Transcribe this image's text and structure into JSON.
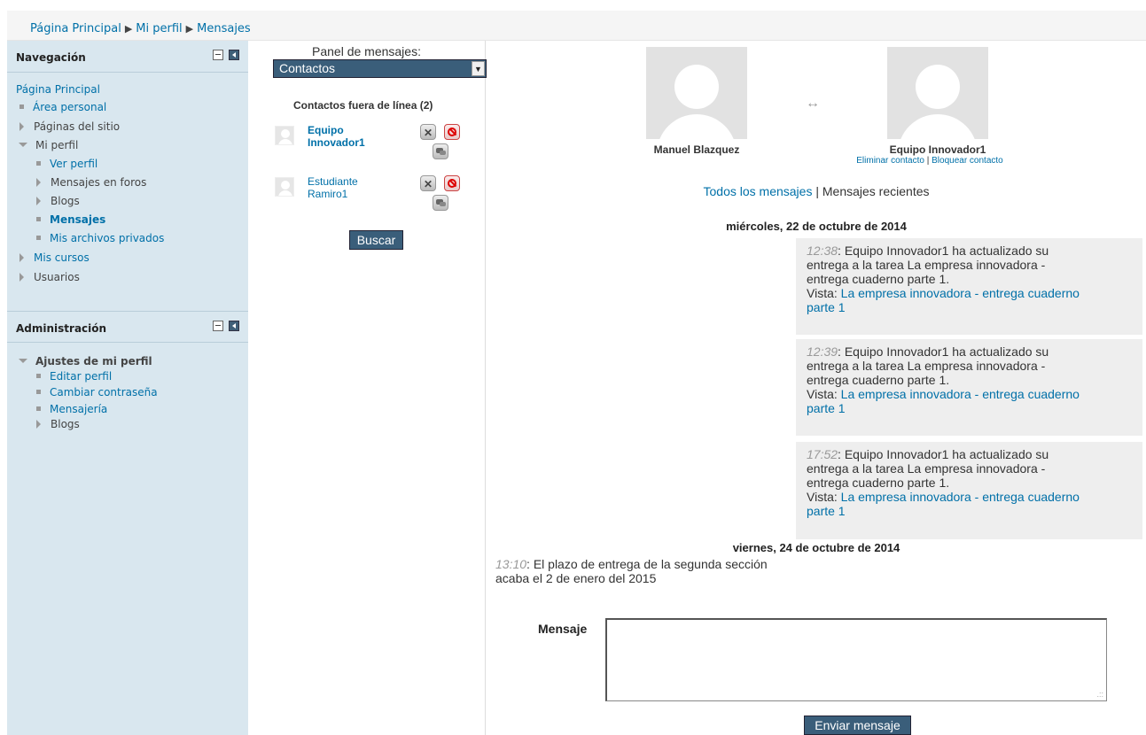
{
  "breadcrumb": {
    "items": [
      "Página Principal",
      "Mi perfil",
      "Mensajes"
    ],
    "separator": "▶"
  },
  "navigation_block": {
    "title": "Navegación",
    "home": "Página Principal",
    "items": [
      {
        "label": "Área personal",
        "marker": "bullet"
      },
      {
        "label": "Páginas del sitio",
        "marker": "collapsed"
      },
      {
        "label": "Mi perfil",
        "marker": "expanded"
      },
      {
        "label": "Ver perfil",
        "marker": "bullet"
      },
      {
        "label": "Mensajes en foros",
        "marker": "collapsed"
      },
      {
        "label": "Blogs",
        "marker": "collapsed"
      },
      {
        "label": "Mensajes",
        "marker": "bullet",
        "active": true
      },
      {
        "label": "Mis archivos privados",
        "marker": "bullet"
      },
      {
        "label": "Mis cursos",
        "marker": "collapsed"
      },
      {
        "label": "Usuarios",
        "marker": "collapsed"
      }
    ]
  },
  "admin_block": {
    "title": "Administración",
    "items": [
      {
        "label": "Ajustes de mi perfil",
        "marker": "expanded"
      },
      {
        "label": "Editar perfil",
        "marker": "bullet"
      },
      {
        "label": "Cambiar contraseña",
        "marker": "bullet"
      },
      {
        "label": "Mensajería",
        "marker": "bullet"
      },
      {
        "label": "Blogs",
        "marker": "collapsed"
      }
    ]
  },
  "panel": {
    "title": "Panel de mensajes:",
    "selected": "Contactos",
    "offline_title": "Contactos fuera de línea (2)",
    "contacts": [
      {
        "name_line1": "Equipo",
        "name_line2": "Innovador1",
        "bold": true
      },
      {
        "name_line1": "Estudiante",
        "name_line2": "Ramiro1",
        "bold": false
      }
    ],
    "search_button": "Buscar"
  },
  "conversation": {
    "user_self": "Manuel Blazquez",
    "user_contact": "Equipo Innovador1",
    "remove_contact": "Eliminar contacto",
    "action_sep": "|",
    "block_contact": "Bloquear contacto",
    "filter_all": "Todos los mensajes",
    "filter_sep": "|",
    "filter_recent": "Mensajes recientes",
    "day1": "miércoles, 22 de octubre de 2014",
    "day2": "viernes, 24 de octubre de 2014",
    "messages": [
      {
        "time": "12:38",
        "text1": ": Equipo Innovador1 ha actualizado su",
        "text2": "entrega a la tarea  La empresa innovadora -",
        "text3": "entrega cuaderno parte 1.",
        "view_label": "Vista: ",
        "view_link": "La empresa innovadora - entrega cuaderno",
        "view_link2": "parte 1"
      },
      {
        "time": "12:39",
        "text1": ": Equipo Innovador1 ha actualizado su",
        "text2": "entrega a la tarea  La empresa innovadora -",
        "text3": "entrega cuaderno parte 1.",
        "view_label": "Vista: ",
        "view_link": "La empresa innovadora - entrega cuaderno",
        "view_link2": "parte 1"
      },
      {
        "time": "17:52",
        "text1": ": Equipo Innovador1 ha actualizado su",
        "text2": "entrega a la tarea  La empresa innovadora -",
        "text3": "entrega cuaderno parte 1.",
        "view_label": "Vista: ",
        "view_link": "La empresa innovadora - entrega cuaderno",
        "view_link2": "parte 1"
      }
    ],
    "sent": {
      "time": "13:10",
      "line1": ": El plazo de entrega de la segunda sección",
      "line2": "acaba el 2 de enero del 2015"
    },
    "compose_label": "Mensaje",
    "send_button": "Enviar mensaje"
  },
  "colors": {
    "link": "#0070a8",
    "button": "#3a5e7a",
    "sidebar": "#d9e7ef"
  }
}
